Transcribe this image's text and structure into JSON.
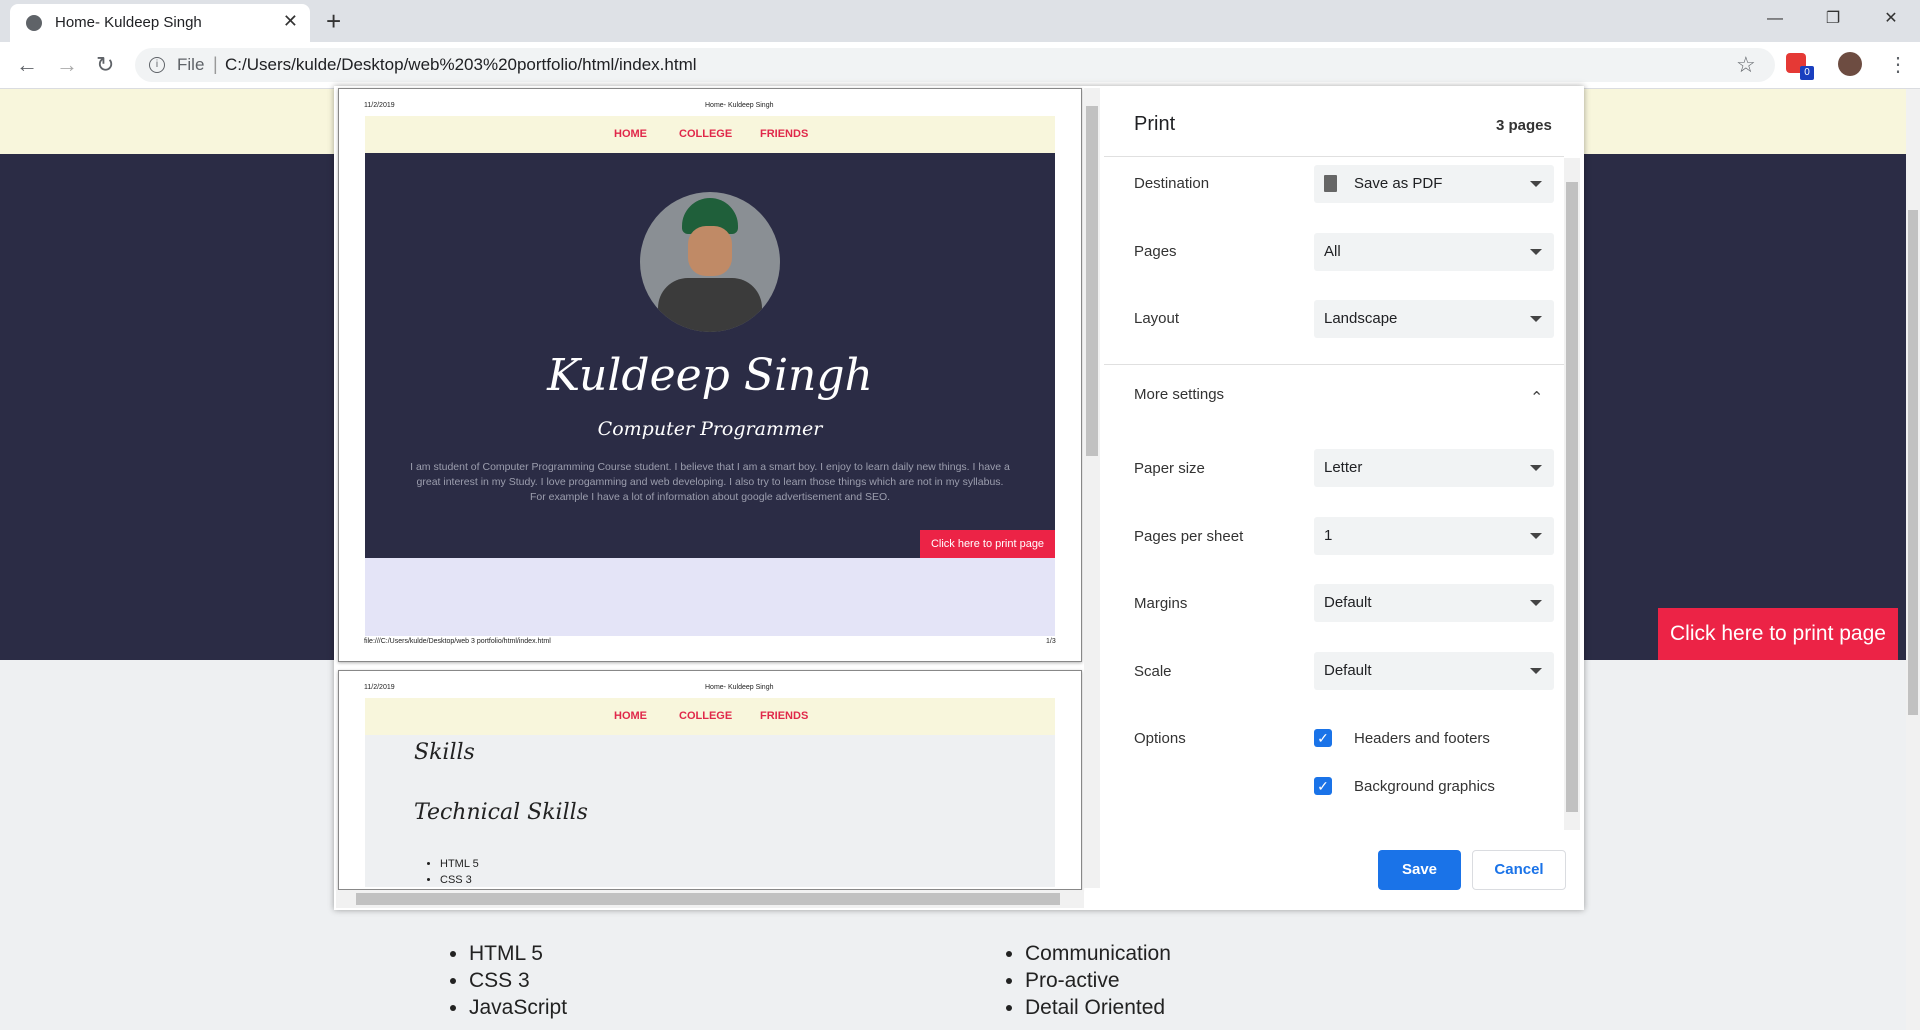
{
  "browser": {
    "tab_title": "Home- Kuldeep Singh",
    "address_scheme": "File",
    "address_url": "C:/Users/kulde/Desktop/web%203%20portfolio/html/index.html",
    "ext_badge": "0"
  },
  "page": {
    "print_button": "Click here to print page",
    "technical_skills": [
      "HTML 5",
      "CSS 3",
      "JavaScript"
    ],
    "soft_skills": [
      "Communication",
      "Pro-active",
      "Detail Oriented"
    ]
  },
  "preview": {
    "date": "11/2/2019",
    "header_title": "Home- Kuldeep Singh",
    "nav": [
      "HOME",
      "COLLEGE",
      "FRIENDS"
    ],
    "name": "Kuldeep Singh",
    "role": "Computer Programmer",
    "bio": "I am student of Computer Programming Course student. I believe that I am a smart boy. I enjoy to learn daily new things. I have a great interest in my Study. I love progamming and web developing. I also try to learn those things which are not in my syllabus. For example I have a lot of information about google advertisement and SEO.",
    "print_button": "Click here to print page",
    "footer_path": "file:///C:/Users/kulde/Desktop/web 3 portfolio/html/index.html",
    "page_number": "1/3",
    "skills_heading": "Skills",
    "technical_heading": "Technical Skills",
    "skills": [
      "HTML 5",
      "CSS 3"
    ]
  },
  "print": {
    "title": "Print",
    "page_count": "3 pages",
    "destination_label": "Destination",
    "destination_value": "Save as PDF",
    "pages_label": "Pages",
    "pages_value": "All",
    "layout_label": "Layout",
    "layout_value": "Landscape",
    "more_settings_label": "More settings",
    "paper_size_label": "Paper size",
    "paper_size_value": "Letter",
    "pages_per_sheet_label": "Pages per sheet",
    "pages_per_sheet_value": "1",
    "margins_label": "Margins",
    "margins_value": "Default",
    "scale_label": "Scale",
    "scale_value": "Default",
    "options_label": "Options",
    "headers_footers_label": "Headers and footers",
    "background_graphics_label": "Background graphics",
    "save_label": "Save",
    "cancel_label": "Cancel"
  }
}
